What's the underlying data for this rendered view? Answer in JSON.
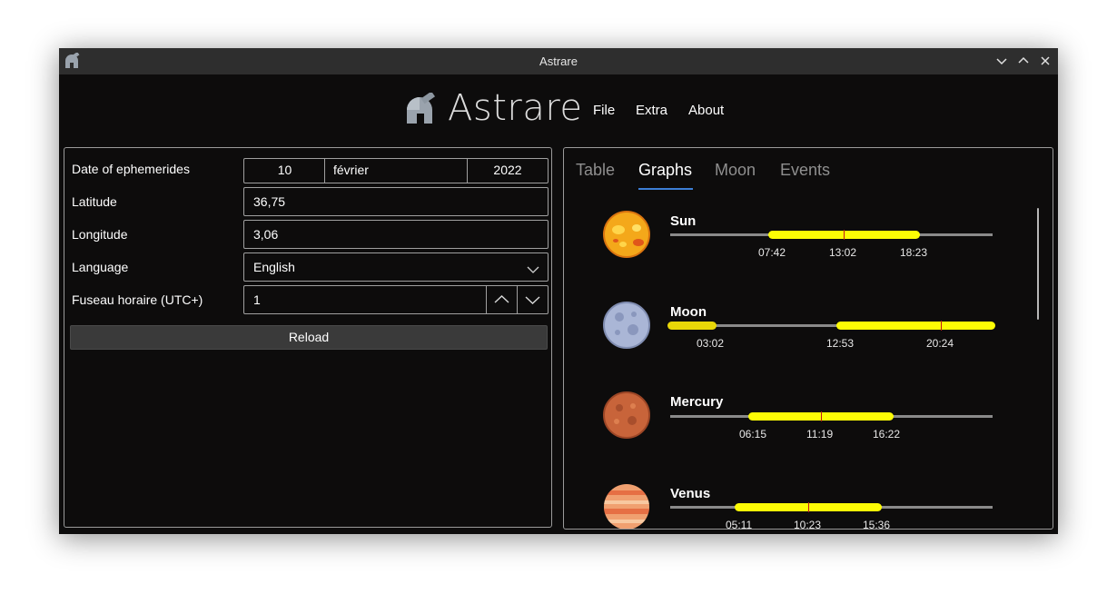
{
  "window": {
    "title": "Astrare"
  },
  "header": {
    "app_name": "Astrare",
    "menu": [
      "File",
      "Extra",
      "About"
    ]
  },
  "form": {
    "date_label": "Date of ephemerides",
    "day": "10",
    "month": "février",
    "year": "2022",
    "latitude_label": "Latitude",
    "latitude": "36,75",
    "longitude_label": "Longitude",
    "longitude": "3,06",
    "language_label": "Language",
    "language": "English",
    "timezone_label": "Fuseau horaire (UTC+)",
    "timezone": "1",
    "reload_label": "Reload"
  },
  "tabs": [
    "Table",
    "Graphs",
    "Moon",
    "Events"
  ],
  "active_tab": "Graphs",
  "graphs": [
    {
      "name": "Sun",
      "rise": "07:42",
      "culmination": "13:02",
      "set": "18:23"
    },
    {
      "name": "Moon",
      "rise": "12:53",
      "culmination": "20:24",
      "set": "03:02"
    },
    {
      "name": "Mercury",
      "rise": "06:15",
      "culmination": "11:19",
      "set": "16:22"
    },
    {
      "name": "Venus",
      "rise": "05:11",
      "culmination": "10:23",
      "set": "15:36"
    }
  ],
  "colors": {
    "visibility_bar": "#fcfc05",
    "transit_marker": "#c01818",
    "tab_underline": "#3d7fd6"
  },
  "icons": [
    "telescope-icon",
    "minimize-icon",
    "maximize-icon",
    "close-icon",
    "chevron-down-icon",
    "chevron-up-icon"
  ]
}
